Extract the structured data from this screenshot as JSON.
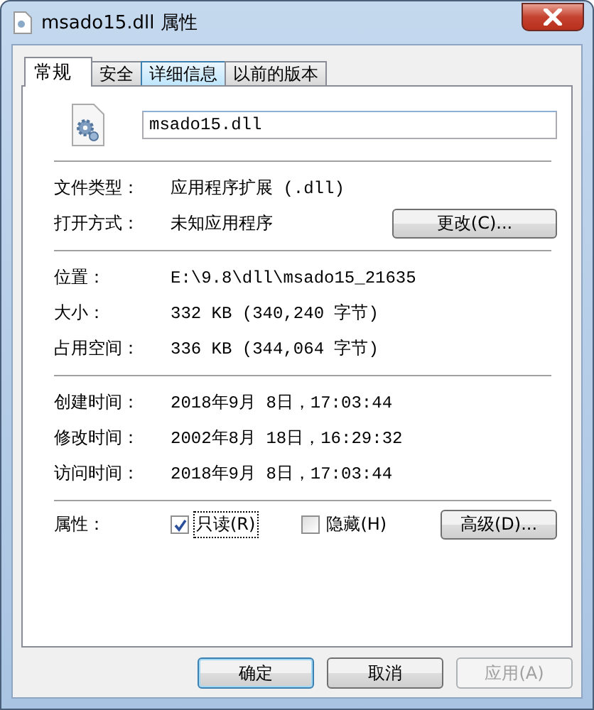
{
  "window": {
    "title": "msado15.dll 属性"
  },
  "tabs": [
    {
      "label": "常规",
      "selected": true,
      "hovered": false
    },
    {
      "label": "安全",
      "selected": false,
      "hovered": false
    },
    {
      "label": "详细信息",
      "selected": false,
      "hovered": true
    },
    {
      "label": "以前的版本",
      "selected": false,
      "hovered": false
    }
  ],
  "file_name": {
    "value": "msado15.dll"
  },
  "groups": [
    {
      "rows": [
        {
          "label": "文件类型：",
          "value": "应用程序扩展 (.dll)"
        },
        {
          "label": "打开方式：",
          "value": "未知应用程序",
          "button": "更改(C)..."
        }
      ]
    },
    {
      "rows": [
        {
          "label": "位置：",
          "value": "E:\\9.8\\dll\\msado15_21635"
        },
        {
          "label": "大小：",
          "value": "332 KB (340,240 字节)"
        },
        {
          "label": "占用空间：",
          "value": "336 KB (344,064 字节)"
        }
      ]
    },
    {
      "rows": [
        {
          "label": "创建时间：",
          "value": "2018年9月 8日，17:03:44"
        },
        {
          "label": "修改时间：",
          "value": "2002年8月 18日，16:29:32"
        },
        {
          "label": "访问时间：",
          "value": "2018年9月 8日，17:03:44"
        }
      ]
    }
  ],
  "attributes": {
    "label": "属性：",
    "options": [
      {
        "label": "只读(R)",
        "checked": true,
        "focused": true
      },
      {
        "label": "隐藏(H)",
        "checked": false,
        "focused": false
      }
    ],
    "button": "高级(D)..."
  },
  "buttons": [
    {
      "label": "确定",
      "default": true,
      "disabled": false
    },
    {
      "label": "取消",
      "default": false,
      "disabled": false
    },
    {
      "label": "应用(A)",
      "default": false,
      "disabled": true
    }
  ]
}
